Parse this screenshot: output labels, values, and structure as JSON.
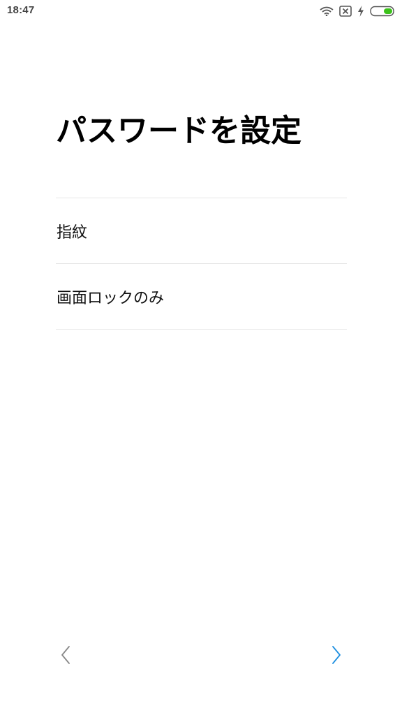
{
  "status_bar": {
    "time": "18:47",
    "icons": [
      "wifi-icon",
      "no-sim-icon",
      "charging-icon",
      "battery-icon"
    ],
    "battery_color": "#3cc21b"
  },
  "page": {
    "title": "パスワードを設定"
  },
  "options": [
    {
      "label": "指紋"
    },
    {
      "label": "画面ロックのみ"
    }
  ],
  "navigation": {
    "back_icon": "chevron-left-icon",
    "next_icon": "chevron-right-icon",
    "back_color": "#888888",
    "next_color": "#1e8fe0"
  }
}
